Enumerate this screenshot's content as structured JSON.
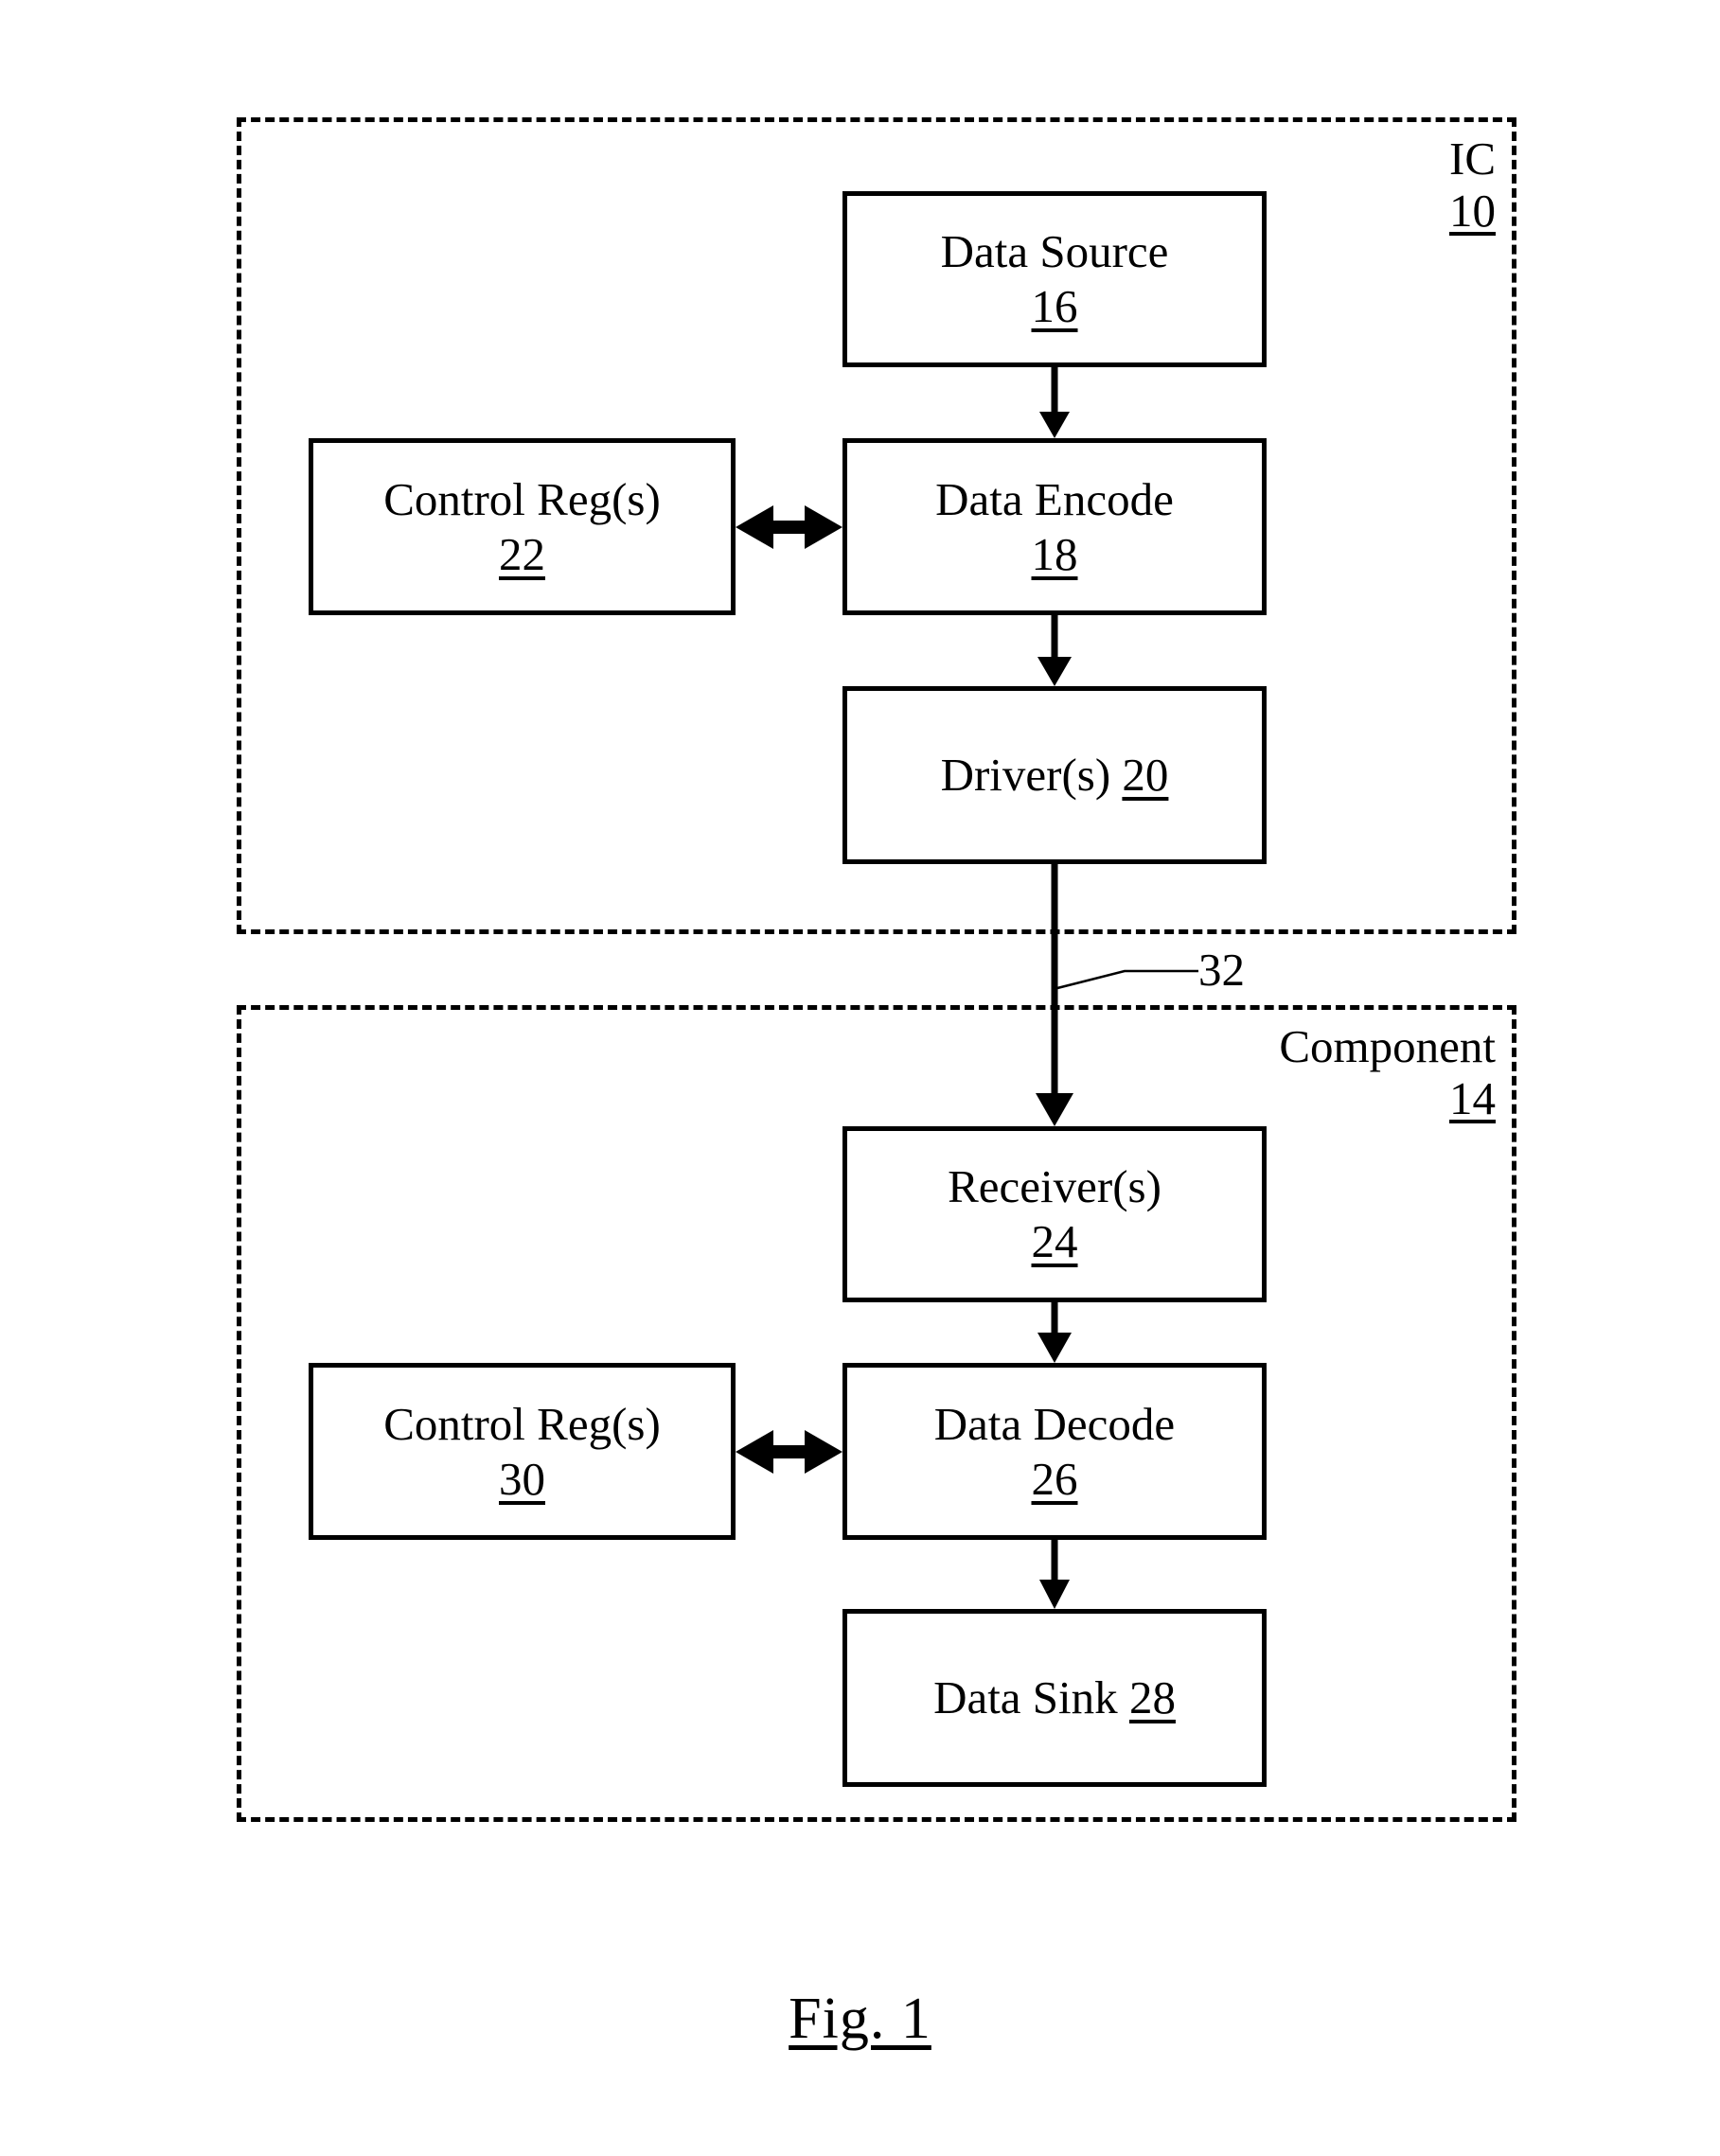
{
  "figure": {
    "caption": "Fig. 1",
    "type": "block-diagram"
  },
  "containers": [
    {
      "id": "ic",
      "label": "IC",
      "ref": "10",
      "style": "dashed"
    },
    {
      "id": "component",
      "label": "Component",
      "ref": "14",
      "style": "dashed"
    }
  ],
  "blocks": {
    "data_source": {
      "label": "Data Source",
      "ref": "16",
      "ref_inline": false
    },
    "data_encode": {
      "label": "Data Encode",
      "ref": "18",
      "ref_inline": false
    },
    "driver": {
      "label": "Driver(s)",
      "ref": "20",
      "ref_inline": true
    },
    "control_reg_tx": {
      "label": "Control Reg(s)",
      "ref": "22",
      "ref_inline": false
    },
    "receiver": {
      "label": "Receiver(s)",
      "ref": "24",
      "ref_inline": false
    },
    "data_decode": {
      "label": "Data Decode",
      "ref": "26",
      "ref_inline": false
    },
    "data_sink": {
      "label": "Data Sink",
      "ref": "28",
      "ref_inline": true
    },
    "control_reg_rx": {
      "label": "Control Reg(s)",
      "ref": "30",
      "ref_inline": false
    }
  },
  "connectors": {
    "channel_ref": "32",
    "edges": [
      {
        "from": "data_source",
        "to": "data_encode",
        "arrow": "single-down"
      },
      {
        "from": "control_reg_tx",
        "to": "data_encode",
        "arrow": "double-horizontal"
      },
      {
        "from": "data_encode",
        "to": "driver",
        "arrow": "single-down"
      },
      {
        "from": "driver",
        "to": "receiver",
        "arrow": "single-down",
        "ref": "32"
      },
      {
        "from": "receiver",
        "to": "data_decode",
        "arrow": "single-down"
      },
      {
        "from": "control_reg_rx",
        "to": "data_decode",
        "arrow": "double-horizontal"
      },
      {
        "from": "data_decode",
        "to": "data_sink",
        "arrow": "single-down"
      }
    ]
  },
  "colors": {
    "ink": "#000000",
    "paper": "#ffffff"
  }
}
